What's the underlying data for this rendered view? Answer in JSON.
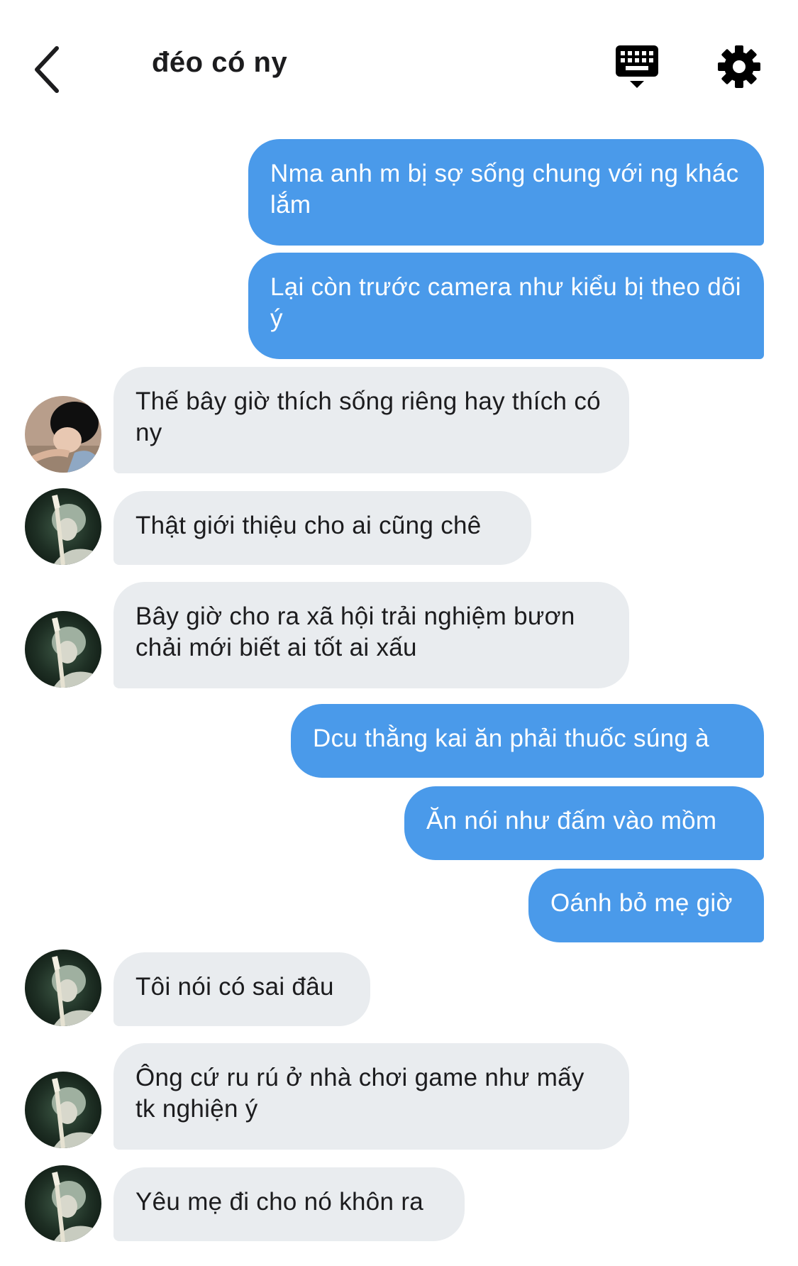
{
  "header": {
    "title": "đéo có ny",
    "back_icon": "chevron-left-icon",
    "keyboard_icon": "keyboard-icon",
    "settings_icon": "gear-icon"
  },
  "colors": {
    "outgoing_bubble": "#4a9aea",
    "incoming_bubble": "#e9ecef",
    "text_dark": "#1c1c1e"
  },
  "messages": [
    {
      "direction": "out",
      "text": "Nma anh m bị sợ sống chung với ng khác lắm"
    },
    {
      "direction": "out",
      "text": "Lại còn trước camera như kiểu bị theo dõi ý"
    },
    {
      "direction": "in",
      "avatar": "boy-photo-avatar",
      "text": "Thế bây giờ thích sống riêng hay thích có ny"
    },
    {
      "direction": "in",
      "avatar": "guitar-artwork-avatar",
      "text": "Thật giới thiệu cho ai cũng chê"
    },
    {
      "direction": "in",
      "avatar": "guitar-artwork-avatar",
      "text": "Bây giờ cho ra xã hội trải nghiệm bươn chải mới biết ai tốt ai xấu"
    },
    {
      "direction": "out",
      "text": "Dcu thằng kai ăn phải thuốc súng à"
    },
    {
      "direction": "out",
      "text": "Ăn nói như đấm vào mồm"
    },
    {
      "direction": "out",
      "text": "Oánh bỏ mẹ giờ"
    },
    {
      "direction": "in",
      "avatar": "guitar-artwork-avatar",
      "text": "Tôi nói có sai đâu"
    },
    {
      "direction": "in",
      "avatar": "guitar-artwork-avatar",
      "text": "Ông cứ ru rú ở nhà chơi game như mấy tk nghiện ý"
    },
    {
      "direction": "in",
      "avatar": "guitar-artwork-avatar",
      "text": "Yêu mẹ đi cho nó khôn ra"
    }
  ]
}
